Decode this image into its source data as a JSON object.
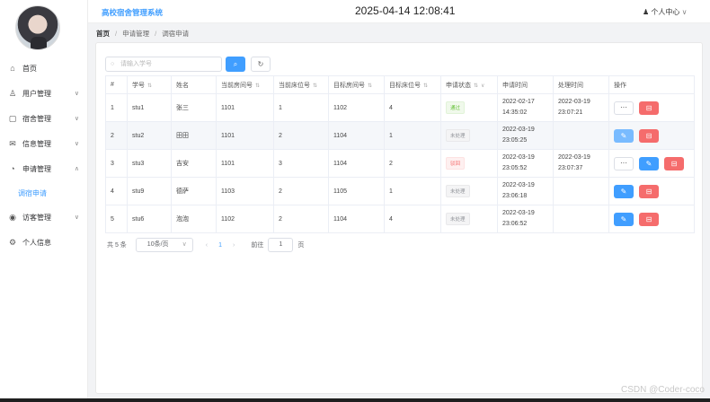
{
  "app": {
    "title": "高校宿舍管理系统",
    "clock": "2025-04-14 12:08:41"
  },
  "user": {
    "label": "个人中心",
    "icon": "user-icon"
  },
  "sidebar": {
    "items": [
      {
        "label": "首页",
        "icon": "home-icon"
      },
      {
        "label": "用户管理",
        "icon": "user-icon"
      },
      {
        "label": "宿舍管理",
        "icon": "building-icon"
      },
      {
        "label": "信息管理",
        "icon": "mail-icon"
      },
      {
        "label": "申请管理",
        "icon": "pie-chart-icon"
      },
      {
        "label": "调宿申请",
        "icon": ""
      },
      {
        "label": "访客管理",
        "icon": "eye-icon"
      },
      {
        "label": "个人信息",
        "icon": "gear-icon"
      }
    ]
  },
  "breadcrumb": {
    "home": "首页",
    "section": "申请管理",
    "page": "调宿申请"
  },
  "search": {
    "placeholder": "请输入学号",
    "search_icon": "search-icon",
    "refresh_icon": "refresh-icon"
  },
  "table": {
    "headers": [
      "#",
      "学号",
      "姓名",
      "当前房间号",
      "当前床位号",
      "目标房间号",
      "目标床位号",
      "申请状态",
      "申请时间",
      "处理时间",
      "操作"
    ],
    "rows": [
      {
        "no": "1",
        "sid": "stu1",
        "name": "张三",
        "cur_room": "1101",
        "cur_bed": "1",
        "tgt_room": "1102",
        "tgt_bed": "4",
        "status": "通过",
        "apply_time": "2022-02-17 14:35:02",
        "proc_time": "2022-03-19 23:07:21"
      },
      {
        "no": "2",
        "sid": "stu2",
        "name": "田田",
        "cur_room": "1101",
        "cur_bed": "2",
        "tgt_room": "1104",
        "tgt_bed": "1",
        "status": "未处理",
        "apply_time": "2022-03-19 23:05:25",
        "proc_time": ""
      },
      {
        "no": "3",
        "sid": "stu3",
        "name": "吉安",
        "cur_room": "1101",
        "cur_bed": "3",
        "tgt_room": "1104",
        "tgt_bed": "2",
        "status": "驳回",
        "apply_time": "2022-03-19 23:05:52",
        "proc_time": "2022-03-19 23:07:37"
      },
      {
        "no": "4",
        "sid": "stu9",
        "name": "德萨",
        "cur_room": "1103",
        "cur_bed": "2",
        "tgt_room": "1105",
        "tgt_bed": "1",
        "status": "未处理",
        "apply_time": "2022-03-19 23:06:18",
        "proc_time": ""
      },
      {
        "no": "5",
        "sid": "stu6",
        "name": "泡泡",
        "cur_room": "1102",
        "cur_bed": "2",
        "tgt_room": "1104",
        "tgt_bed": "4",
        "status": "未处理",
        "apply_time": "2022-03-19 23:06:52",
        "proc_time": ""
      }
    ]
  },
  "pager": {
    "total": "共 5 条",
    "size": "10条/页",
    "current": "1",
    "goto": "前往",
    "goto_value": "1",
    "page_unit": "页"
  },
  "watermark": "CSDN @Coder-coco"
}
